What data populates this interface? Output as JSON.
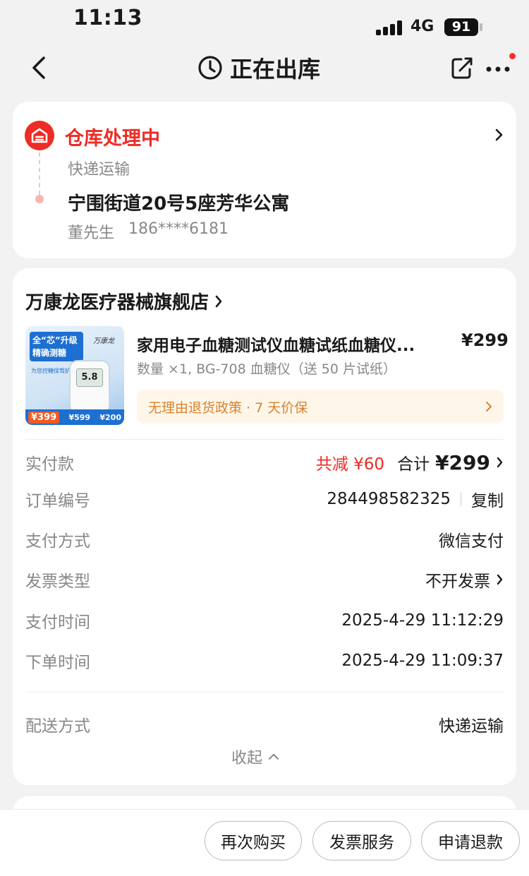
{
  "status_bar": {
    "time": "11:13",
    "network": "4G",
    "battery": "91"
  },
  "nav": {
    "title": "正在出库"
  },
  "shipment": {
    "status": "仓库处理中",
    "method": "快递运输",
    "address": "宁围街道20号5座芳华公寓",
    "recipient_name": "董先生",
    "recipient_phone": "186****6181"
  },
  "shop": {
    "name": "万康龙医疗器械旗舰店"
  },
  "product": {
    "title": "家用电子血糖测试仪血糖试纸血糖仪...",
    "price": "¥299",
    "spec": "数量 ×1, BG-708 血糖仪（送 50 片试纸）",
    "policy": "无理由退货政策 · 7 天价保",
    "thumbnail": {
      "badge_line1": "全“芯”升级",
      "badge_line2": "精确测糖",
      "brand": "万康龙",
      "subtitle": "为您控糖保驾护航",
      "screen_value": "5.8",
      "price_main": "¥399",
      "price_alt1": "¥599",
      "price_alt2": "¥200"
    }
  },
  "order_details": {
    "paid_label": "实付款",
    "discount": "共减 ¥60",
    "total_label": "合计",
    "total_amount": "¥299",
    "order_no_label": "订单编号",
    "order_no": "284498582325",
    "copy_label": "复制",
    "pay_method_label": "支付方式",
    "pay_method": "微信支付",
    "invoice_type_label": "发票类型",
    "invoice_type": "不开发票",
    "pay_time_label": "支付时间",
    "pay_time": "2025-4-29 11:12:29",
    "order_time_label": "下单时间",
    "order_time": "2025-4-29 11:09:37",
    "delivery_label": "配送方式",
    "delivery": "快递运输",
    "collapse_label": "收起"
  },
  "actions": {
    "buy_again": "再次购买",
    "invoice_service": "发票服务",
    "refund": "申请退款"
  },
  "colors": {
    "accent_red": "#ee2b24",
    "policy_orange": "#d9822b",
    "policy_bg": "#fff6ea"
  }
}
